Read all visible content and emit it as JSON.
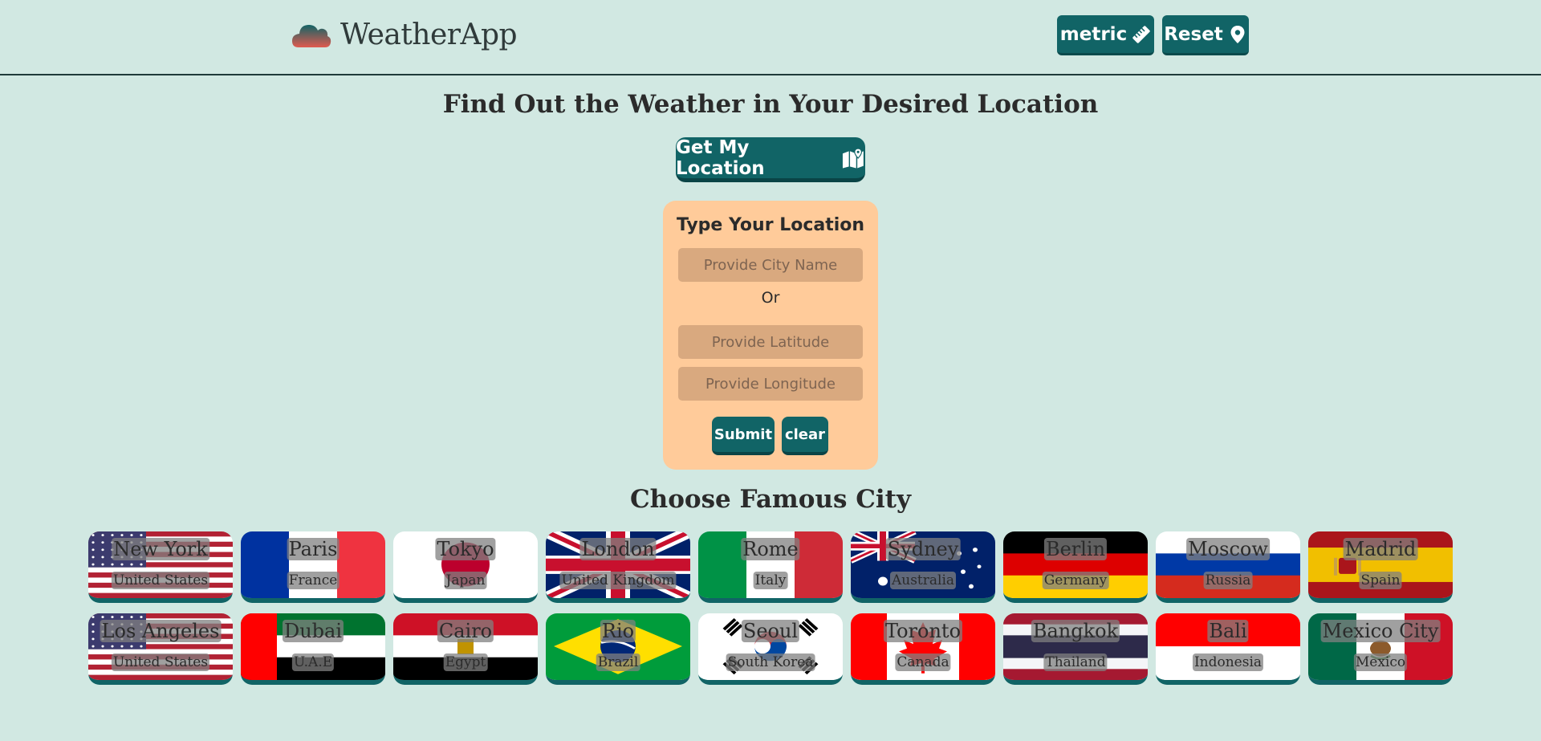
{
  "header": {
    "app_title": "WeatherApp",
    "logo_icon": "cloud-icon",
    "metric_label": "metric",
    "metric_icon": "ruler-icon",
    "reset_label": "Reset",
    "reset_icon": "map-pin-icon"
  },
  "main": {
    "title": "Find Out the Weather in Your Desired Location",
    "location_button": "Get My Location",
    "location_icon": "map-location-icon"
  },
  "form": {
    "title": "Type Your Location",
    "city_placeholder": "Provide City Name",
    "or_label": "Or",
    "lat_placeholder": "Provide Latitude",
    "lon_placeholder": "Provide Longitude",
    "submit_label": "Submit",
    "clear_label": "clear"
  },
  "cities_section": {
    "title": "Choose Famous City",
    "cities": [
      {
        "city": "New York",
        "country": "United States",
        "flag": "us-flag"
      },
      {
        "city": "Paris",
        "country": "France",
        "flag": "fr-flag"
      },
      {
        "city": "Tokyo",
        "country": "Japan",
        "flag": "jp-flag"
      },
      {
        "city": "London",
        "country": "United Kingdom",
        "flag": "uk-flag"
      },
      {
        "city": "Rome",
        "country": "Italy",
        "flag": "it-flag"
      },
      {
        "city": "Sydney",
        "country": "Australia",
        "flag": "au-flag"
      },
      {
        "city": "Berlin",
        "country": "Germany",
        "flag": "de-flag"
      },
      {
        "city": "Moscow",
        "country": "Russia",
        "flag": "ru-flag"
      },
      {
        "city": "Madrid",
        "country": "Spain",
        "flag": "es-flag"
      },
      {
        "city": "Los Angeles",
        "country": "United States",
        "flag": "us-flag"
      },
      {
        "city": "Dubai",
        "country": "U.A.E",
        "flag": "ae-flag"
      },
      {
        "city": "Cairo",
        "country": "Egypt",
        "flag": "eg-flag"
      },
      {
        "city": "Rio",
        "country": "Brazil",
        "flag": "br-flag"
      },
      {
        "city": "Seoul",
        "country": "South Korea",
        "flag": "kr-flag"
      },
      {
        "city": "Toronto",
        "country": "Canada",
        "flag": "ca-flag"
      },
      {
        "city": "Bangkok",
        "country": "Thailand",
        "flag": "th-flag"
      },
      {
        "city": "Bali",
        "country": "Indonesia",
        "flag": "id-flag"
      },
      {
        "city": "Mexico City",
        "country": "Mexico",
        "flag": "mx-flag"
      }
    ]
  },
  "colors": {
    "background": "#d1e8e2",
    "accent": "#116466",
    "form_background": "#ffcb9a",
    "field_background": "#d9a97f"
  }
}
